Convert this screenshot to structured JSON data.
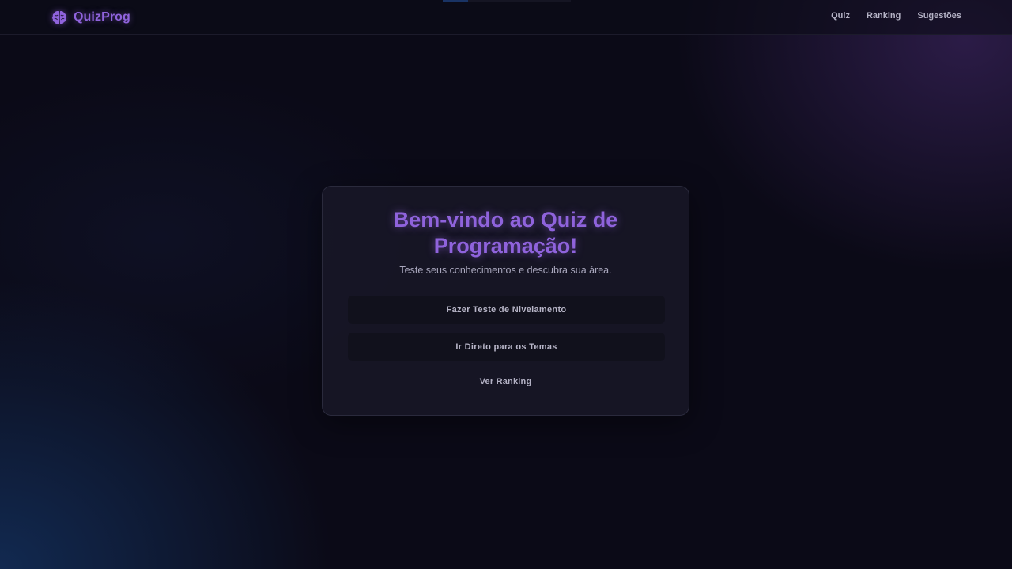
{
  "app": {
    "name": "QuizProg",
    "logo_icon": "brain-icon",
    "accent_color": "#8f63dc"
  },
  "loading": {
    "progress": 0.2
  },
  "nav": {
    "items": [
      {
        "label": "Quiz"
      },
      {
        "label": "Ranking"
      },
      {
        "label": "Sugestões"
      }
    ]
  },
  "welcome": {
    "title": "Bem-vindo ao Quiz de Programação!",
    "subtitle": "Teste seus conhecimentos e descubra sua área.",
    "primary_button": "Fazer Teste de Nivelamento",
    "secondary_button": "Ir Direto para os Temas",
    "ranking_link": "Ver Ranking"
  }
}
